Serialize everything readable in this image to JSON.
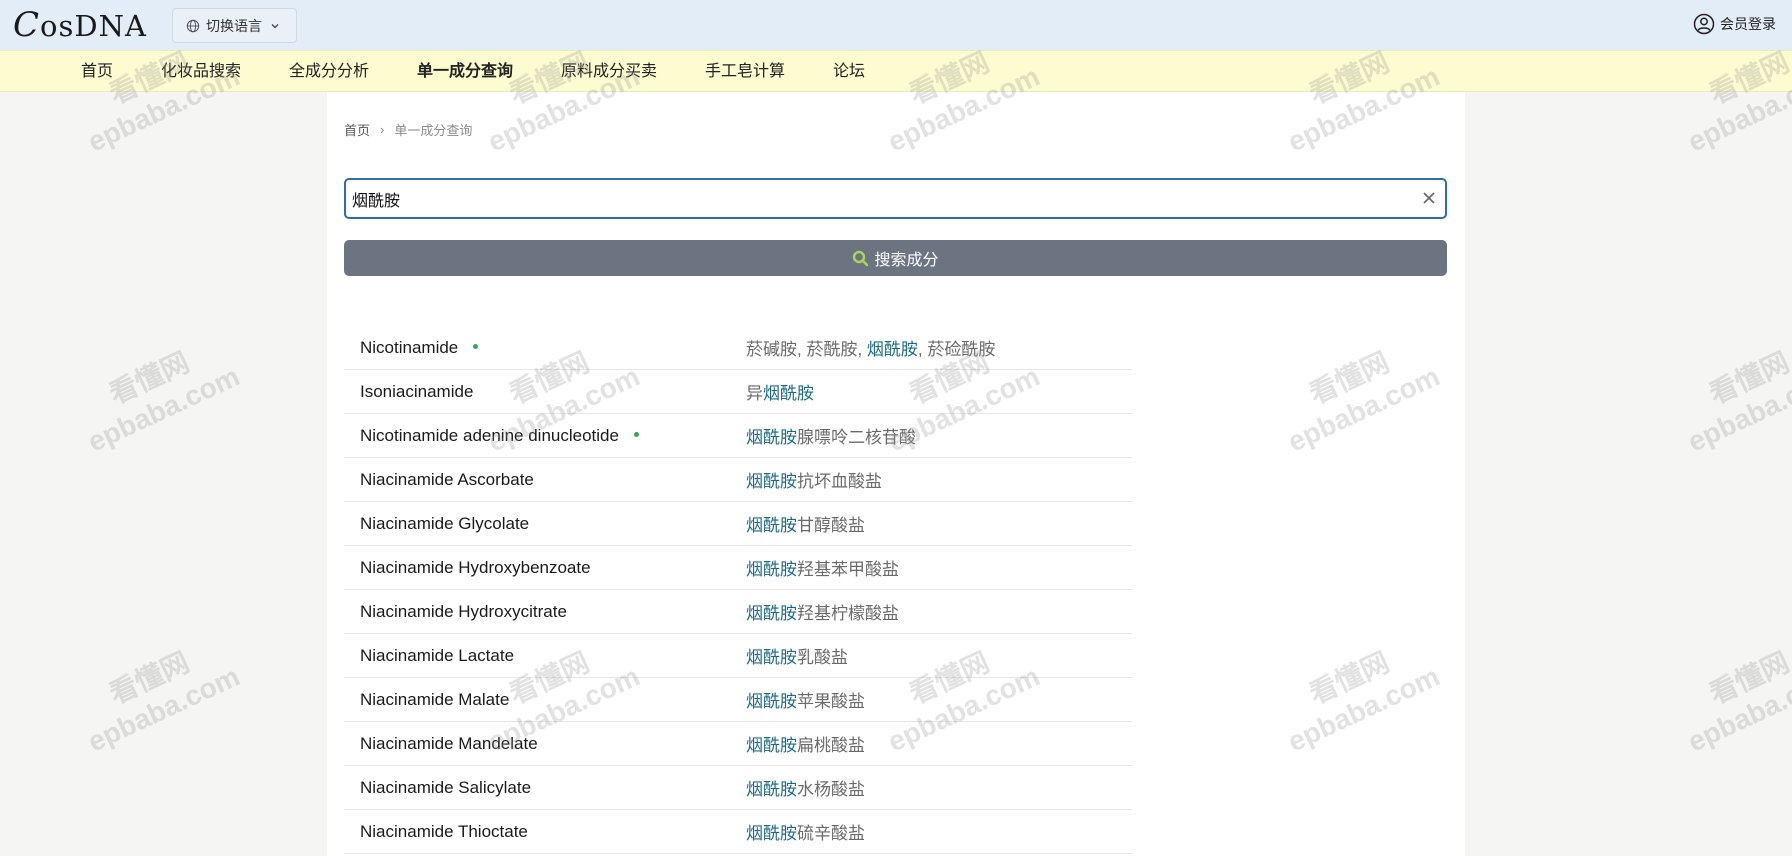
{
  "header": {
    "logo_text": "CosDNA",
    "language_button": "切换语言",
    "login_label": "会员登录"
  },
  "nav": [
    {
      "label": "首页",
      "active": false
    },
    {
      "label": "化妆品搜索",
      "active": false
    },
    {
      "label": "全成分分析",
      "active": false
    },
    {
      "label": "单一成分查询",
      "active": true
    },
    {
      "label": "原料成分买卖",
      "active": false
    },
    {
      "label": "手工皂计算",
      "active": false
    },
    {
      "label": "论坛",
      "active": false
    }
  ],
  "breadcrumb": {
    "home": "首页",
    "separator": "›",
    "current": "单一成分查询"
  },
  "search": {
    "value": "烟酰胺",
    "button_label": "搜索成分"
  },
  "results": [
    {
      "en": "Nicotinamide",
      "dot": true,
      "zh_parts": [
        [
          "菸碱胺, 菸酰胺, ",
          false
        ],
        [
          "烟酰胺",
          true
        ],
        [
          ", 菸硷酰胺",
          false
        ]
      ]
    },
    {
      "en": "Isoniacinamide",
      "dot": false,
      "zh_parts": [
        [
          "异",
          false
        ],
        [
          "烟酰胺",
          true
        ]
      ]
    },
    {
      "en": "Nicotinamide adenine dinucleotide",
      "dot": true,
      "zh_parts": [
        [
          "烟酰胺",
          true
        ],
        [
          "腺嘌呤二核苷酸",
          false
        ]
      ]
    },
    {
      "en": "Niacinamide Ascorbate",
      "dot": false,
      "zh_parts": [
        [
          "烟酰胺",
          true
        ],
        [
          "抗坏血酸盐",
          false
        ]
      ]
    },
    {
      "en": "Niacinamide Glycolate",
      "dot": false,
      "zh_parts": [
        [
          "烟酰胺",
          true
        ],
        [
          "甘醇酸盐",
          false
        ]
      ]
    },
    {
      "en": "Niacinamide Hydroxybenzoate",
      "dot": false,
      "zh_parts": [
        [
          "烟酰胺",
          true
        ],
        [
          "羟基苯甲酸盐",
          false
        ]
      ]
    },
    {
      "en": "Niacinamide Hydroxycitrate",
      "dot": false,
      "zh_parts": [
        [
          "烟酰胺",
          true
        ],
        [
          "羟基柠檬酸盐",
          false
        ]
      ]
    },
    {
      "en": "Niacinamide Lactate",
      "dot": false,
      "zh_parts": [
        [
          "烟酰胺",
          true
        ],
        [
          "乳酸盐",
          false
        ]
      ]
    },
    {
      "en": "Niacinamide Malate",
      "dot": false,
      "zh_parts": [
        [
          "烟酰胺",
          true
        ],
        [
          "苹果酸盐",
          false
        ]
      ]
    },
    {
      "en": "Niacinamide Mandelate",
      "dot": false,
      "zh_parts": [
        [
          "烟酰胺",
          true
        ],
        [
          "扁桃酸盐",
          false
        ]
      ]
    },
    {
      "en": "Niacinamide Salicylate",
      "dot": false,
      "zh_parts": [
        [
          "烟酰胺",
          true
        ],
        [
          "水杨酸盐",
          false
        ]
      ]
    },
    {
      "en": "Niacinamide Thioctate",
      "dot": false,
      "zh_parts": [
        [
          "烟酰胺",
          true
        ],
        [
          "硫辛酸盐",
          false
        ]
      ]
    }
  ],
  "watermark": {
    "line1": "看懂网",
    "line2": "epbaba.com"
  },
  "colors": {
    "topbar": "#e3edf8",
    "navbar": "#fdfbd0",
    "search_border": "#2a6fa8",
    "search_button": "#6b7480",
    "search_icon": "#a6d65c",
    "highlight": "#1f6a86",
    "status_dot": "#3aa558"
  }
}
